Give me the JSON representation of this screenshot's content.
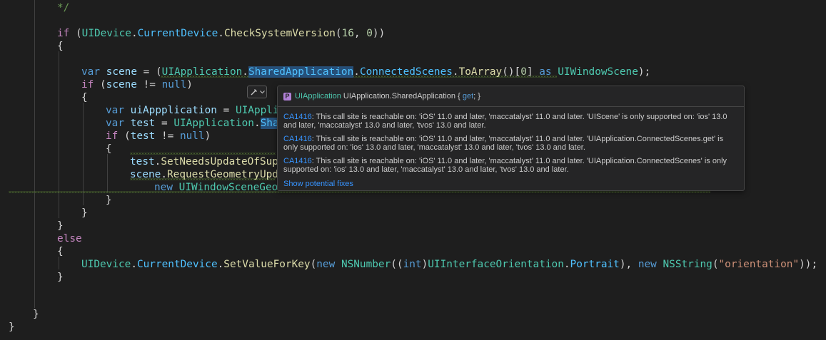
{
  "editor": {
    "comment_end": "*/",
    "if_keyword": "if",
    "else_keyword": "else",
    "var_keyword": "var",
    "as_keyword": "as",
    "null_keyword": "null",
    "new_keyword": "new",
    "int_keyword": "int",
    "UIDevice": "UIDevice",
    "CurrentDevice": "CurrentDevice",
    "CheckSystemVersion": "CheckSystemVersion",
    "version_major": "16",
    "version_minor": "0",
    "scene": "scene",
    "test": "test",
    "uiAppplication": "uiAppplication",
    "UIApplication": "UIApplication",
    "SharedApplication": "SharedApplication",
    "SharedApplication_truncated": "Sha",
    "UIAppli_truncated": "UIAppli",
    "ConnectedScenes": "ConnectedScenes",
    "ToArray": "ToArray",
    "index_zero": "0",
    "UIWindowScene": "UIWindowScene",
    "SetNeedsUpdateOfSup": "SetNeedsUpdateOfSup",
    "RequestGeometryUpd": "RequestGeometryUpd",
    "UIWindowSceneGeo": "UIWindowSceneGeo",
    "SetValueForKey": "SetValueForKey",
    "NSNumber": "NSNumber",
    "UIInterfaceOrientation": "UIInterfaceOrientation",
    "Portrait": "Portrait",
    "NSString": "NSString",
    "orientation_literal": "\"orientation\""
  },
  "hover": {
    "sig_type": "UIApplication",
    "sig_member": " UIApplication.SharedApplication { ",
    "sig_get": "get",
    "sig_tail": "; }",
    "prop_icon_glyph": "P",
    "diagnostics": [
      {
        "code": "CA1416",
        "message": ": This call site is reachable on: 'iOS' 11.0 and later, 'maccatalyst' 11.0 and later. 'UIScene' is only supported on: 'ios' 13.0 and later, 'maccatalyst' 13.0 and later, 'tvos' 13.0 and later."
      },
      {
        "code": "CA1416",
        "message": ": This call site is reachable on: 'iOS' 11.0 and later, 'maccatalyst' 11.0 and later. 'UIApplication.ConnectedScenes.get' is only supported on: 'ios' 13.0 and later, 'maccatalyst' 13.0 and later, 'tvos' 13.0 and later."
      },
      {
        "code": "CA1416",
        "message": ": This call site is reachable on: 'iOS' 11.0 and later, 'maccatalyst' 11.0 and later. 'UIApplication.ConnectedScenes' is only supported on: 'ios' 13.0 and later, 'maccatalyst' 13.0 and later, 'tvos' 13.0 and later."
      }
    ],
    "show_fixes": "Show potential fixes"
  },
  "icons": {
    "lightbulb": "quick-fix-icon",
    "chevron": "chevron-down-icon",
    "property": "property-icon"
  },
  "colors": {
    "background": "#1e1e1e",
    "keyword": "#569cd6",
    "type": "#4ec9b0",
    "method": "#dcdcaa",
    "link": "#3794ff",
    "warning_squiggle": "#6a9a3a"
  }
}
